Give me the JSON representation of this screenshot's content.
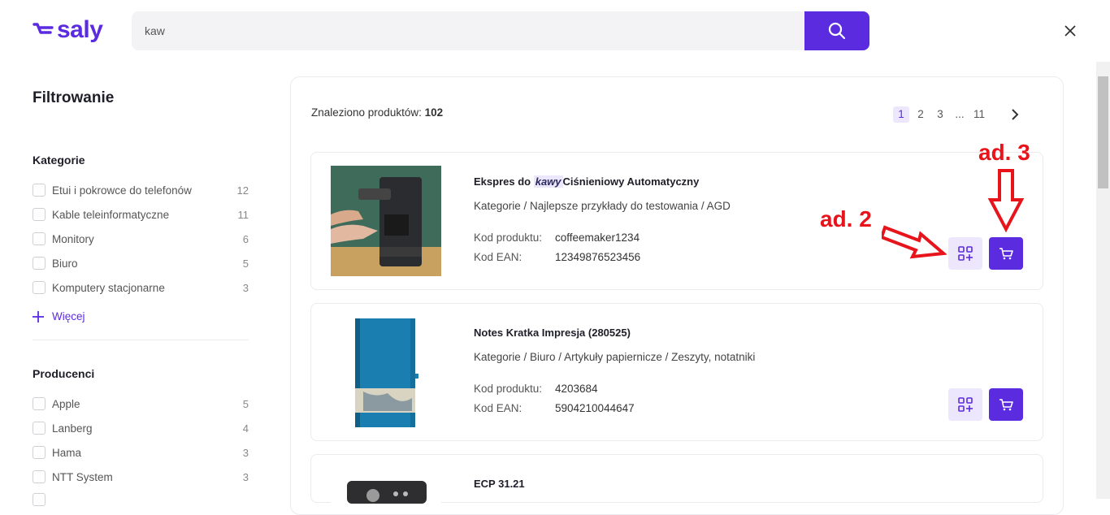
{
  "header": {
    "logo_text": "saly",
    "search_value": "kaw",
    "search_icon": "search-icon",
    "close_icon": "close-icon"
  },
  "sidebar": {
    "title": "Filtrowanie",
    "categories": {
      "title": "Kategorie",
      "items": [
        {
          "label": "Etui i pokrowce do telefonów",
          "count": "12"
        },
        {
          "label": "Kable teleinformatyczne",
          "count": "11"
        },
        {
          "label": "Monitory",
          "count": "6"
        },
        {
          "label": "Biuro",
          "count": "5"
        },
        {
          "label": "Komputery stacjonarne",
          "count": "3"
        }
      ],
      "more_label": "Więcej"
    },
    "producers": {
      "title": "Producenci",
      "items": [
        {
          "label": "Apple",
          "count": "5"
        },
        {
          "label": "Lanberg",
          "count": "4"
        },
        {
          "label": "Hama",
          "count": "3"
        },
        {
          "label": "NTT System",
          "count": "3"
        }
      ]
    }
  },
  "results": {
    "found_label": "Znaleziono produktów:",
    "found_count": "102",
    "pagination": {
      "pages": [
        "1",
        "2",
        "3",
        "...",
        "11"
      ],
      "current": "1"
    },
    "products": [
      {
        "name_prefix": "Ekspres do",
        "name_highlight": "kawy",
        "name_suffix": "Ciśnieniowy Automatyczny",
        "category": "Kategorie / Najlepsze przykłady do testowania / AGD",
        "code_label": "Kod produktu:",
        "code": "coffeemaker1234",
        "ean_label": "Kod EAN:",
        "ean": "12349876523456"
      },
      {
        "name": "Notes Kratka Impresja (280525)",
        "category": "Kategorie / Biuro / Artykuły papiernicze / Zeszyty, notatniki",
        "code_label": "Kod produktu:",
        "code": "4203684",
        "ean_label": "Kod EAN:",
        "ean": "5904210044647"
      },
      {
        "name": "ECP 31.21"
      }
    ]
  },
  "annotations": {
    "compare_label": "ad. 2",
    "cart_label": "ad. 3",
    "color": "#e8141c"
  },
  "colors": {
    "accent": "#5b2be0",
    "accent_light": "#ece7fc"
  }
}
